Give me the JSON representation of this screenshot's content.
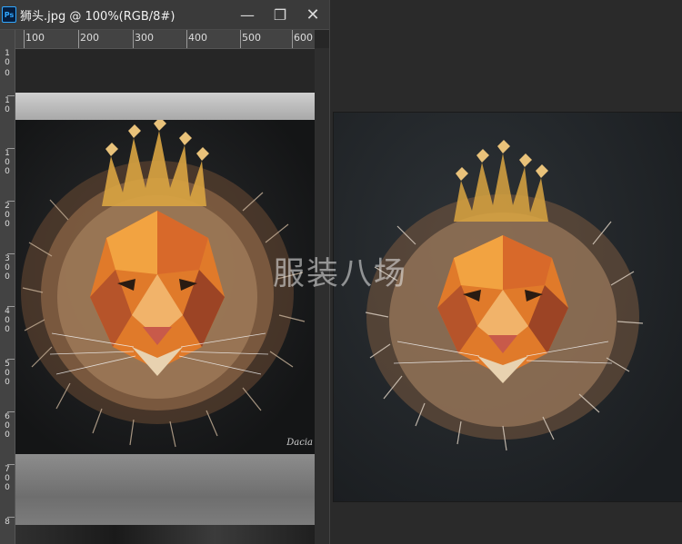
{
  "window": {
    "title": "狮头.jpg @ 100%(RGB/8#)",
    "app_icon_label": "Ps",
    "minimize_glyph": "—",
    "maximize_glyph": "❐",
    "close_glyph": "✕"
  },
  "ruler": {
    "horizontal_labels": [
      "100",
      "200",
      "300",
      "400",
      "500",
      "600"
    ],
    "vertical_labels": [
      "1",
      "0",
      "0",
      "1",
      "0",
      "1",
      "0",
      "0",
      "2",
      "0",
      "0",
      "3",
      "0",
      "0",
      "4",
      "0",
      "0",
      "5",
      "0",
      "0",
      "6",
      "0",
      "0",
      "7",
      "0",
      "0",
      "8"
    ]
  },
  "document": {
    "subject": "geometric lion head with crown",
    "signature_text": "Dacia"
  },
  "preview": {
    "subject": "lion head with crown, background removed"
  },
  "watermark": {
    "text": "服装八场"
  },
  "colors": {
    "ps_blue": "#31a8ff",
    "titlebar": "#3a3a3a",
    "ruler": "#434343",
    "workspace": "#2a2a2a",
    "crown_gold": "#d9a441",
    "lion_orange": "#e07a2a"
  }
}
